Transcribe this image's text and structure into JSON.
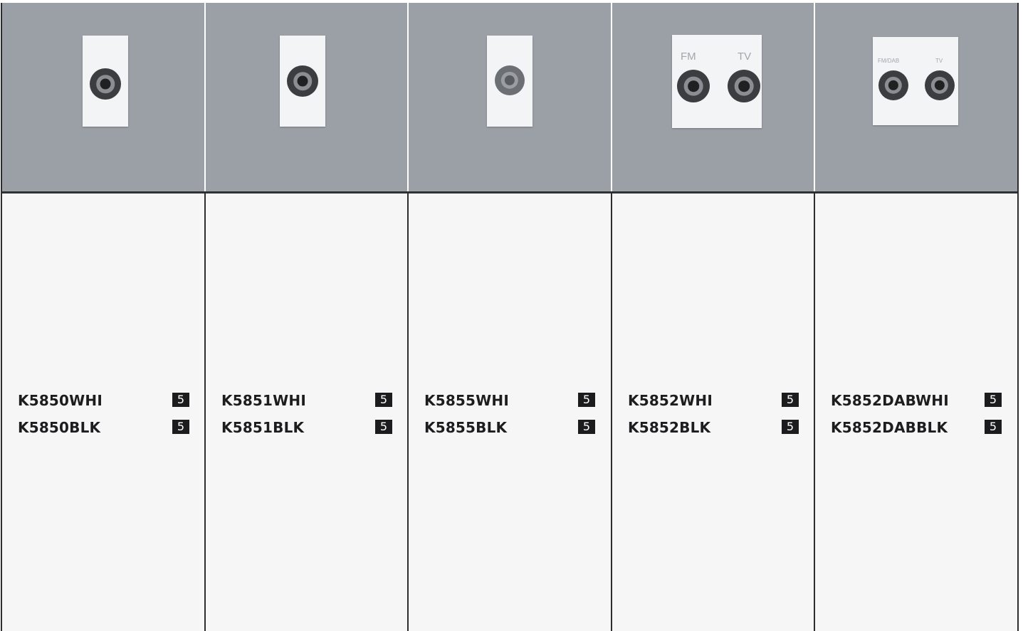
{
  "products": [
    {
      "image": {
        "type": "single-coax",
        "socket_style": "tv",
        "labels": []
      },
      "codes": [
        {
          "code": "K5850WHI",
          "qty": "5"
        },
        {
          "code": "K5850BLK",
          "qty": "5"
        }
      ]
    },
    {
      "image": {
        "type": "single-coax",
        "socket_style": "tv",
        "labels": []
      },
      "codes": [
        {
          "code": "K5851WHI",
          "qty": "5"
        },
        {
          "code": "K5851BLK",
          "qty": "5"
        }
      ]
    },
    {
      "image": {
        "type": "single-f-type",
        "socket_style": "satellite",
        "labels": []
      },
      "codes": [
        {
          "code": "K5855WHI",
          "qty": "5"
        },
        {
          "code": "K5855BLK",
          "qty": "5"
        }
      ]
    },
    {
      "image": {
        "type": "twin-coax",
        "socket_style": "tv",
        "labels": [
          "FM",
          "TV"
        ]
      },
      "codes": [
        {
          "code": "K5852WHI",
          "qty": "5"
        },
        {
          "code": "K5852BLK",
          "qty": "5"
        }
      ]
    },
    {
      "image": {
        "type": "twin-coax",
        "socket_style": "tv",
        "labels": [
          "FM/DAB",
          "TV"
        ]
      },
      "codes": [
        {
          "code": "K5852DABWHI",
          "qty": "5"
        },
        {
          "code": "K5852DABBLK",
          "qty": "5"
        }
      ]
    }
  ],
  "colors": {
    "image_bg": "#9ba0a6",
    "info_bg": "#f6f6f6",
    "rule": "#2b2d30",
    "badge_bg": "#1c1c1e"
  }
}
